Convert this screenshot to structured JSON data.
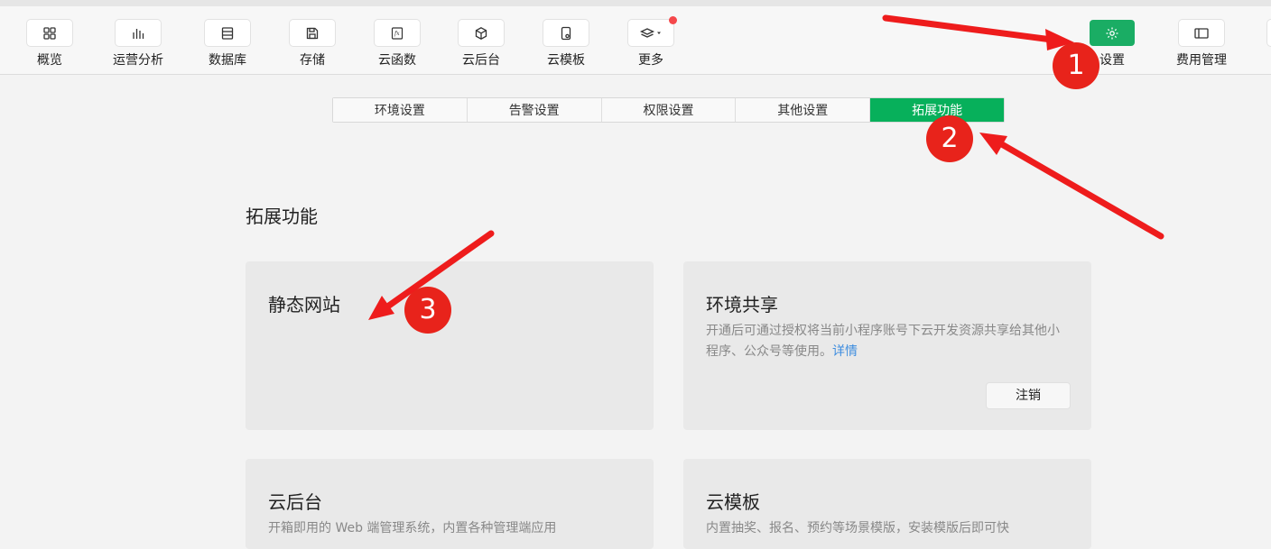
{
  "toolbar": {
    "items": [
      {
        "label": "概览",
        "icon": "grid-icon"
      },
      {
        "label": "运营分析",
        "icon": "bar-chart-icon"
      },
      {
        "label": "数据库",
        "icon": "database-icon"
      },
      {
        "label": "存储",
        "icon": "save-icon"
      },
      {
        "label": "云函数",
        "icon": "function-icon"
      },
      {
        "label": "云后台",
        "icon": "cube-icon"
      },
      {
        "label": "云模板",
        "icon": "template-icon"
      },
      {
        "label": "更多",
        "icon": "layers-icon"
      },
      {
        "label": "设置",
        "icon": "gear-icon"
      },
      {
        "label": "费用管理",
        "icon": "wallet-icon"
      }
    ],
    "active_color": "#1aad64"
  },
  "tabs": {
    "items": [
      "环境设置",
      "告警设置",
      "权限设置",
      "其他设置",
      "拓展功能"
    ],
    "active": "拓展功能"
  },
  "section": {
    "title": "拓展功能"
  },
  "cards": [
    {
      "title": "静态网站",
      "desc": "",
      "link": "",
      "action": ""
    },
    {
      "title": "环境共享",
      "desc": "开通后可通过授权将当前小程序账号下云开发资源共享给其他小程序、公众号等使用。",
      "link": "详情",
      "action": "注销"
    },
    {
      "title": "云后台",
      "desc": "开箱即用的 Web 端管理系统，内置各种管理端应用",
      "link": "",
      "action": ""
    },
    {
      "title": "云模板",
      "desc": "内置抽奖、报名、预约等场景模版，安装模版后即可快",
      "link": "",
      "action": ""
    }
  ],
  "annotations": [
    "1",
    "2",
    "3"
  ],
  "colors": {
    "accent": "#07b05b",
    "annotation": "#e8231b",
    "link": "#3e8ddf"
  }
}
